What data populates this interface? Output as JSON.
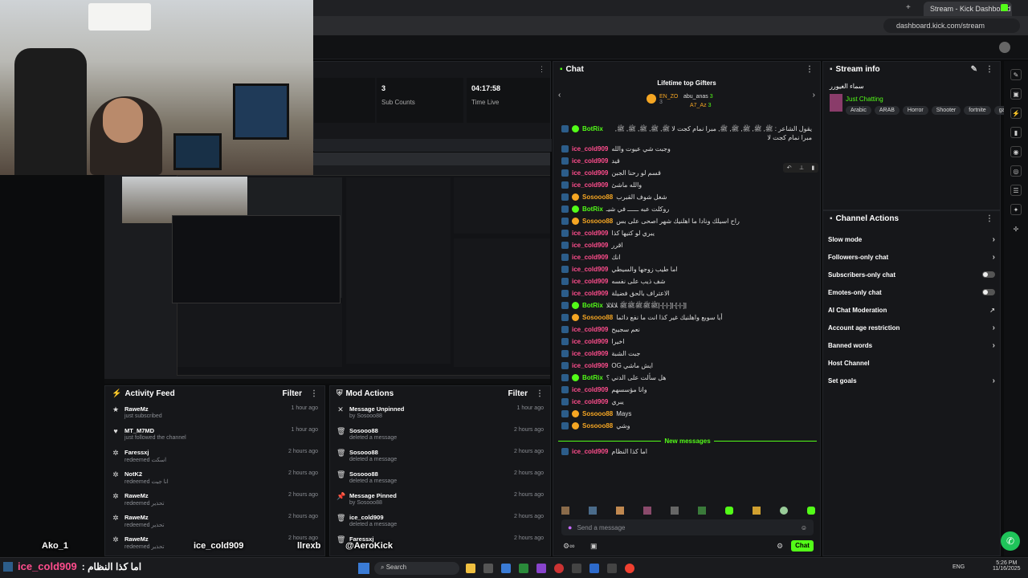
{
  "browser": {
    "tab_title": "Stream - Kick Dashboard",
    "url": "dashboard.kick.com/stream"
  },
  "stats": {
    "sub_counts_value": "3",
    "sub_counts_label": "Sub Counts",
    "time_live_value": "04:17:58",
    "time_live_label": "Time Live"
  },
  "chat": {
    "title": "Chat",
    "gifters_title": "Lifetime top Gifters",
    "gifters": [
      {
        "name": "EN_ZO",
        "count": "3"
      },
      {
        "name": "abu_anas",
        "count": "3"
      },
      {
        "name": "A7_Az",
        "count": "3"
      }
    ],
    "messages": [
      {
        "user": "BotRix",
        "color": "#53fc18",
        "text": "يقول الشاعر : ﷺ, ﷺ, ﷺ, ﷺ, ﷺ, مبرا نمام كجت لا ﷺ, ﷺ, ﷺ, ﷺ, ﷺ, مبرا نمام كجت لا",
        "bot": true
      },
      {
        "user": "ice_cold909",
        "color": "#ff4d8d",
        "text": "وجبت شي عيوت والله"
      },
      {
        "user": "ice_cold909",
        "color": "#ff4d8d",
        "text": "قيد"
      },
      {
        "user": "ice_cold909",
        "color": "#ff4d8d",
        "text": "قسم لو رحنا الجبن"
      },
      {
        "user": "ice_cold909",
        "color": "#ff4d8d",
        "text": "والله ماشئ"
      },
      {
        "user": "Sosooo88",
        "color": "#f5a623",
        "text": "شغل شوف القبرب"
      },
      {
        "user": "BotRix",
        "color": "#53fc18",
        "text": "روكلت عبه ــــــ في شيـ",
        "bot": true
      },
      {
        "user": "Sosooo88",
        "color": "#f5a623",
        "text": "راح اسيلك ونادا ما اهلنيك شهر اصحى على بس"
      },
      {
        "user": "ice_cold909",
        "color": "#ff4d8d",
        "text": "يبري لو كتيها كذا"
      },
      {
        "user": "ice_cold909",
        "color": "#ff4d8d",
        "text": "اقرر"
      },
      {
        "user": "ice_cold909",
        "color": "#ff4d8d",
        "text": "انك"
      },
      {
        "user": "ice_cold909",
        "color": "#ff4d8d",
        "text": "اما طيب زوجها والسيطي"
      },
      {
        "user": "ice_cold909",
        "color": "#ff4d8d",
        "text": "شف ذيب على نفسه"
      },
      {
        "user": "ice_cold909",
        "color": "#ff4d8d",
        "text": "الاعتراف بالحق فضيلة"
      },
      {
        "user": "BotRix",
        "color": "#53fc18",
        "text": "|[-|-]-|[-|-]-|ﷺﷺﷺﷺﷺ ﻼﻼﻼ",
        "bot": true
      },
      {
        "user": "Sosooo88",
        "color": "#f5a623",
        "text": "أيا سوبع واهلنيك غير كذا انت ما نفع دائما"
      },
      {
        "user": "ice_cold909",
        "color": "#ff4d8d",
        "text": "نعم سجيبح"
      },
      {
        "user": "ice_cold909",
        "color": "#ff4d8d",
        "text": "اخيرا"
      },
      {
        "user": "ice_cold909",
        "color": "#ff4d8d",
        "text": "جبت الشبة"
      },
      {
        "user": "ice_cold909",
        "color": "#ff4d8d",
        "text": "OG ايش ماشي"
      },
      {
        "user": "BotRix",
        "color": "#53fc18",
        "text": "هل سألت على الدني ؟",
        "bot": true
      },
      {
        "user": "ice_cold909",
        "color": "#ff4d8d",
        "text": "وانا مؤسسهم"
      },
      {
        "user": "ice_cold909",
        "color": "#ff4d8d",
        "text": "يبري"
      },
      {
        "user": "Sosooo88",
        "color": "#f5a623",
        "text": "Mays"
      },
      {
        "user": "Sosooo88",
        "color": "#f5a623",
        "text": "وشي"
      }
    ],
    "new_messages_label": "New messages",
    "new_message": {
      "user": "ice_cold909",
      "text": "اما كذا النظام"
    },
    "input_placeholder": "Send a message",
    "send_label": "Chat"
  },
  "stream_info": {
    "title": "Stream info",
    "stream_title": "سماء الغيورر",
    "category": "Just Chatting",
    "tags": [
      "Arabic",
      "ARAB",
      "Horror",
      "Shooter",
      "fortnite",
      "games"
    ]
  },
  "channel_actions": {
    "title": "Channel Actions",
    "items": [
      {
        "label": "Slow mode",
        "control": "chevron"
      },
      {
        "label": "Followers-only chat",
        "control": "chevron"
      },
      {
        "label": "Subscribers-only chat",
        "control": "toggle"
      },
      {
        "label": "Emotes-only chat",
        "control": "toggle"
      },
      {
        "label": "AI Chat Moderation",
        "control": "external"
      },
      {
        "label": "Account age restriction",
        "control": "chevron"
      },
      {
        "label": "Banned words",
        "control": "chevron"
      },
      {
        "label": "Host Channel",
        "control": "none"
      },
      {
        "label": "Set goals",
        "control": "chevron"
      }
    ]
  },
  "activity_feed": {
    "title": "Activity Feed",
    "filter": "Filter",
    "items": [
      {
        "name": "RaweMz",
        "sub": "just subscribed",
        "time": "1 hour ago",
        "icon": "★"
      },
      {
        "name": "MT_M7MD",
        "sub": "just followed the channel",
        "time": "1 hour ago",
        "icon": "♥"
      },
      {
        "name": "Faressxj",
        "sub": "redeemed اسكت",
        "time": "2 hours ago",
        "icon": "✲"
      },
      {
        "name": "NotK2",
        "sub": "redeemed انا جيت",
        "time": "2 hours ago",
        "icon": "✲"
      },
      {
        "name": "RaweMz",
        "sub": "redeemed تحذير",
        "time": "2 hours ago",
        "icon": "✲"
      },
      {
        "name": "RaweMz",
        "sub": "redeemed تحذير",
        "time": "2 hours ago",
        "icon": "✲"
      },
      {
        "name": "RaweMz",
        "sub": "redeemed تحذير",
        "time": "2 hours ago",
        "icon": "✲"
      }
    ]
  },
  "mod_actions": {
    "title": "Mod Actions",
    "filter": "Filter",
    "items": [
      {
        "name": "Message Unpinned",
        "sub": "by Sosooo88",
        "time": "1 hour ago",
        "icon": "✕"
      },
      {
        "name": "Sosooo88",
        "sub": "deleted a message",
        "time": "2 hours ago",
        "icon": "🗑"
      },
      {
        "name": "Sosooo88",
        "sub": "deleted a message",
        "time": "2 hours ago",
        "icon": "🗑"
      },
      {
        "name": "Sosooo88",
        "sub": "deleted a message",
        "time": "2 hours ago",
        "icon": "🗑"
      },
      {
        "name": "Message Pinned",
        "sub": "by Sosooo88",
        "time": "2 hours ago",
        "icon": "📌"
      },
      {
        "name": "ice_cold909",
        "sub": "deleted a message",
        "time": "2 hours ago",
        "icon": "🗑"
      },
      {
        "name": "Faressxj",
        "sub": "",
        "time": "2 hours ago",
        "icon": "🗑"
      }
    ]
  },
  "overlay": {
    "name1": "Ako_1",
    "name2": "ice_cold909",
    "name3": "llrexb",
    "name4": "@AeroKick",
    "bottom_user": "ice_cold909",
    "bottom_text": ": اما كذا النظام"
  },
  "taskbar": {
    "search_label": "Search",
    "lang": "ENG",
    "time": "5:26 PM",
    "date": "11/16/2025"
  }
}
